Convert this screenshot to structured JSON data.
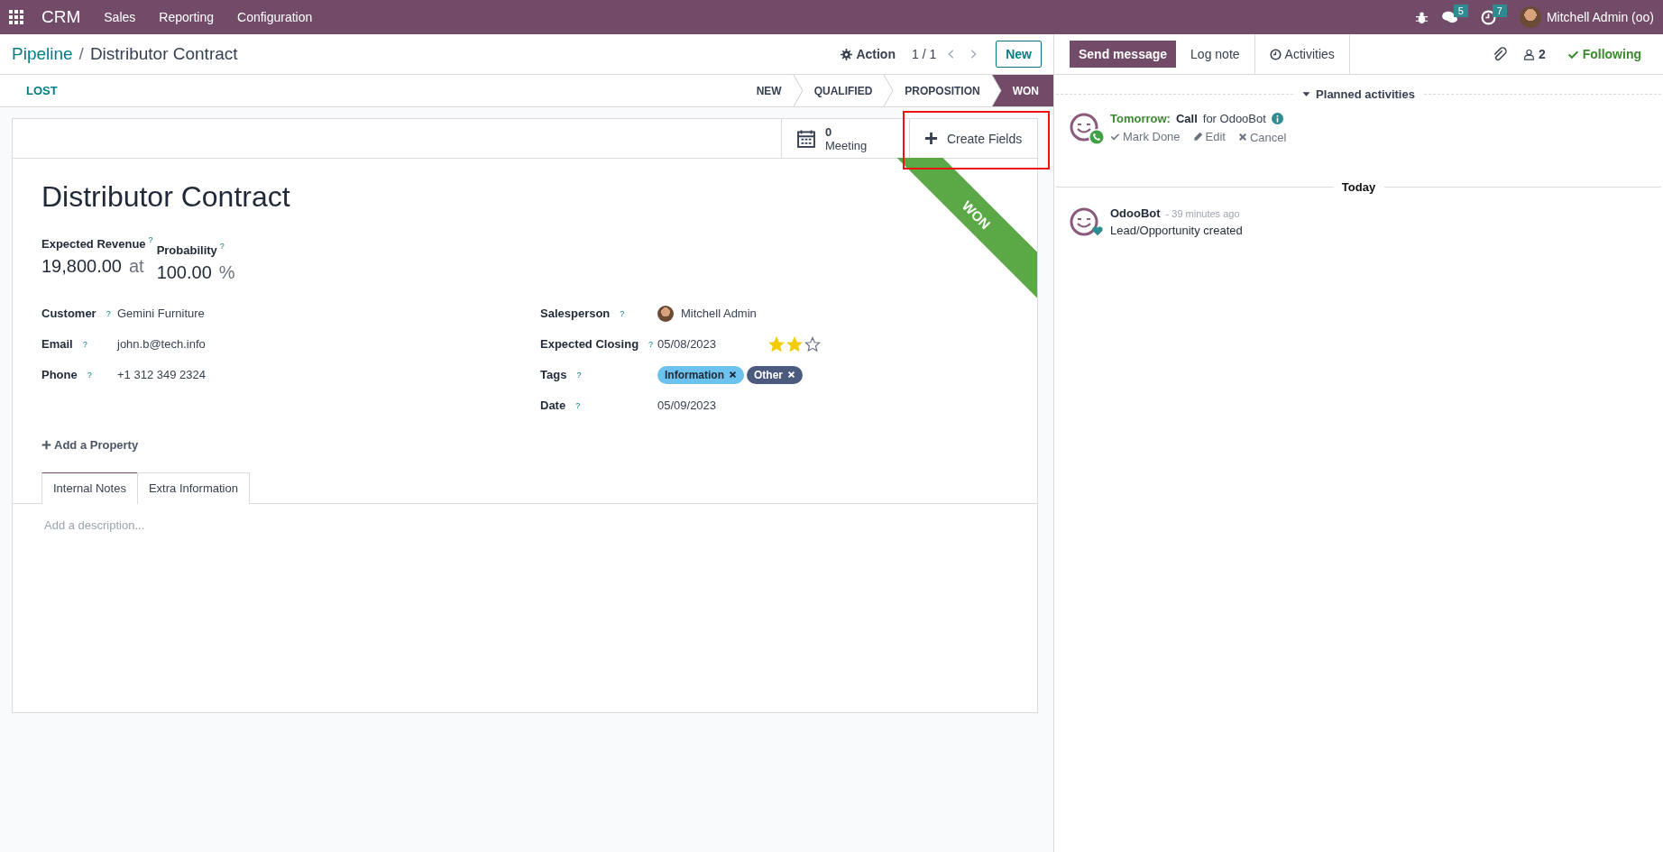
{
  "navbar": {
    "app": "CRM",
    "menu": [
      "Sales",
      "Reporting",
      "Configuration"
    ],
    "messages_count": "5",
    "activities_count": "7",
    "user": "Mitchell Admin (oo)"
  },
  "breadcrumb": {
    "parent": "Pipeline",
    "separator": "/",
    "current": "Distributor Contract"
  },
  "control": {
    "action": "Action",
    "pager": "1 / 1",
    "new": "New"
  },
  "status": {
    "lost": "LOST",
    "stages": [
      {
        "label": "NEW",
        "selected": false
      },
      {
        "label": "QUALIFIED",
        "selected": false
      },
      {
        "label": "PROPOSITION",
        "selected": false
      },
      {
        "label": "WON",
        "selected": true
      }
    ]
  },
  "smart_buttons": [
    {
      "kind": "stat",
      "value": "0",
      "label": "Meeting"
    },
    {
      "kind": "action",
      "label": "Create Fields",
      "highlighted": true
    }
  ],
  "ribbon": "WON",
  "title": "Distributor Contract",
  "revenue": {
    "label": "Expected Revenue",
    "value": "19,800.00",
    "at": "at"
  },
  "probability": {
    "label": "Probability",
    "value": "100.00",
    "unit": "%"
  },
  "left_fields": [
    {
      "label": "Customer",
      "value": "Gemini Furniture"
    },
    {
      "label": "Email",
      "value": "john.b@tech.info"
    },
    {
      "label": "Phone",
      "value": "+1 312 349 2324"
    }
  ],
  "right_fields": [
    {
      "kind": "user",
      "label": "Salesperson",
      "value": "Mitchell Admin"
    },
    {
      "kind": "priority",
      "label": "Expected Closing",
      "value": "05/08/2023",
      "stars": 2
    },
    {
      "kind": "tags",
      "label": "Tags",
      "tags": [
        {
          "label": "Information",
          "color": "#6cc1ed"
        },
        {
          "label": "Other",
          "color": "#4c5b7d"
        }
      ]
    },
    {
      "kind": "text",
      "label": "Date",
      "value": "05/09/2023"
    }
  ],
  "help_mark": "?",
  "add_property": "Add a Property",
  "tabs": [
    {
      "label": "Internal Notes",
      "selected": true
    },
    {
      "label": "Extra Information",
      "selected": false
    }
  ],
  "description": {
    "placeholder": "Add a description..."
  },
  "chatter": {
    "buttons": [
      {
        "label": "Send message",
        "selected": true
      },
      {
        "label": "Log note",
        "selected": false
      },
      {
        "label": "Activities",
        "selected": false
      }
    ],
    "followers": "2",
    "following": "Following",
    "planned_title": "Planned activities",
    "activity": {
      "when": "Tomorrow:",
      "type": "Call",
      "for": "for OdooBot",
      "actions": [
        "Mark Done",
        "Edit",
        "Cancel"
      ]
    },
    "separator": "Today",
    "messages": [
      {
        "author": "OdooBot",
        "time": "- 39 minutes ago",
        "body": "Lead/Opportunity created"
      }
    ]
  }
}
